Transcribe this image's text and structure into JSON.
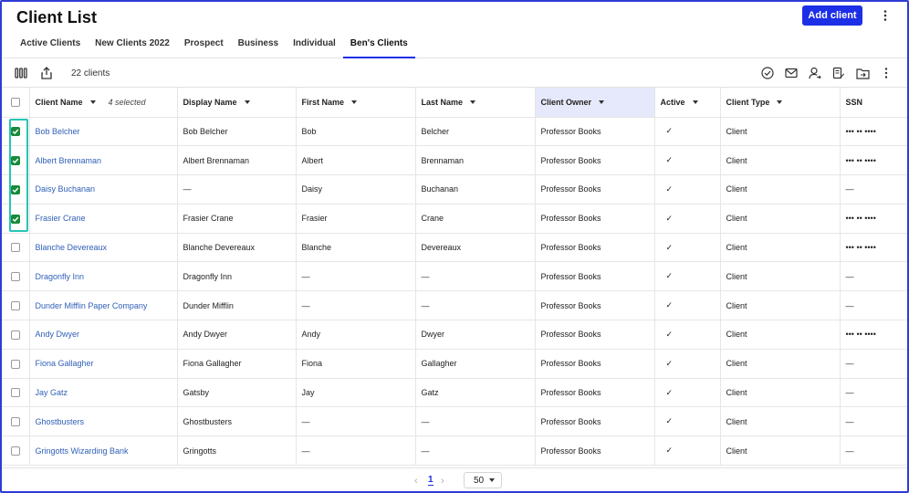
{
  "header": {
    "title": "Client List",
    "add_label": "Add client",
    "tabs": [
      {
        "label": "Active Clients",
        "active": false
      },
      {
        "label": "New Clients 2022",
        "active": false
      },
      {
        "label": "Prospect",
        "active": false
      },
      {
        "label": "Business",
        "active": false
      },
      {
        "label": "Individual",
        "active": false
      },
      {
        "label": "Ben's Clients",
        "active": true
      }
    ]
  },
  "toolbar": {
    "count_text": "22 clients",
    "left_icons": [
      "columns-icon",
      "export-icon"
    ],
    "right_icons": [
      "check-circle-icon",
      "mail-icon",
      "assign-user-icon",
      "edit-note-icon",
      "move-folder-icon",
      "kebab-icon"
    ]
  },
  "table": {
    "selected_text": "4 selected",
    "columns": [
      "Client Name",
      "Display Name",
      "First Name",
      "Last Name",
      "Client Owner",
      "Active",
      "Client Type",
      "SSN"
    ],
    "highlight_column": "Client Owner",
    "rows": [
      {
        "checked": true,
        "client_name": "Bob Belcher",
        "display_name": "Bob Belcher",
        "first_name": "Bob",
        "last_name": "Belcher",
        "owner": "Professor Books",
        "active": "✓",
        "type": "Client",
        "ssn": "••• •• ••••"
      },
      {
        "checked": true,
        "client_name": "Albert Brennaman",
        "display_name": "Albert Brennaman",
        "first_name": "Albert",
        "last_name": "Brennaman",
        "owner": "Professor Books",
        "active": "✓",
        "type": "Client",
        "ssn": "••• •• ••••"
      },
      {
        "checked": true,
        "client_name": "Daisy Buchanan",
        "display_name": "—",
        "first_name": "Daisy",
        "last_name": "Buchanan",
        "owner": "Professor Books",
        "active": "✓",
        "type": "Client",
        "ssn": "—"
      },
      {
        "checked": true,
        "client_name": "Frasier Crane",
        "display_name": "Frasier Crane",
        "first_name": "Frasier",
        "last_name": "Crane",
        "owner": "Professor Books",
        "active": "✓",
        "type": "Client",
        "ssn": "••• •• ••••"
      },
      {
        "checked": false,
        "client_name": "Blanche Devereaux",
        "display_name": "Blanche Devereaux",
        "first_name": "Blanche",
        "last_name": "Devereaux",
        "owner": "Professor Books",
        "active": "✓",
        "type": "Client",
        "ssn": "••• •• ••••"
      },
      {
        "checked": false,
        "client_name": "Dragonfly Inn",
        "display_name": "Dragonfly Inn",
        "first_name": "—",
        "last_name": "—",
        "owner": "Professor Books",
        "active": "✓",
        "type": "Client",
        "ssn": "—"
      },
      {
        "checked": false,
        "client_name": "Dunder Mifflin Paper Company",
        "display_name": "Dunder Mifflin",
        "first_name": "—",
        "last_name": "—",
        "owner": "Professor Books",
        "active": "✓",
        "type": "Client",
        "ssn": "—"
      },
      {
        "checked": false,
        "client_name": "Andy Dwyer",
        "display_name": "Andy Dwyer",
        "first_name": "Andy",
        "last_name": "Dwyer",
        "owner": "Professor Books",
        "active": "✓",
        "type": "Client",
        "ssn": "••• •• ••••"
      },
      {
        "checked": false,
        "client_name": "Fiona Gallagher",
        "display_name": "Fiona Gallagher",
        "first_name": "Fiona",
        "last_name": "Gallagher",
        "owner": "Professor Books",
        "active": "✓",
        "type": "Client",
        "ssn": "—"
      },
      {
        "checked": false,
        "client_name": "Jay Gatz",
        "display_name": "Gatsby",
        "first_name": "Jay",
        "last_name": "Gatz",
        "owner": "Professor Books",
        "active": "✓",
        "type": "Client",
        "ssn": "—"
      },
      {
        "checked": false,
        "client_name": "Ghostbusters",
        "display_name": "Ghostbusters",
        "first_name": "—",
        "last_name": "—",
        "owner": "Professor Books",
        "active": "✓",
        "type": "Client",
        "ssn": "—"
      },
      {
        "checked": false,
        "client_name": "Gringotts Wizarding Bank",
        "display_name": "Gringotts",
        "first_name": "—",
        "last_name": "—",
        "owner": "Professor Books",
        "active": "✓",
        "type": "Client",
        "ssn": "—"
      }
    ]
  },
  "pager": {
    "page": "1",
    "page_size": "50"
  },
  "colors": {
    "accent": "#1d2fe6",
    "check_green": "#1a8a3a",
    "selection_outline": "#28c4b4",
    "link": "#3060b8",
    "owner_header_bg": "#e6e8fb"
  }
}
